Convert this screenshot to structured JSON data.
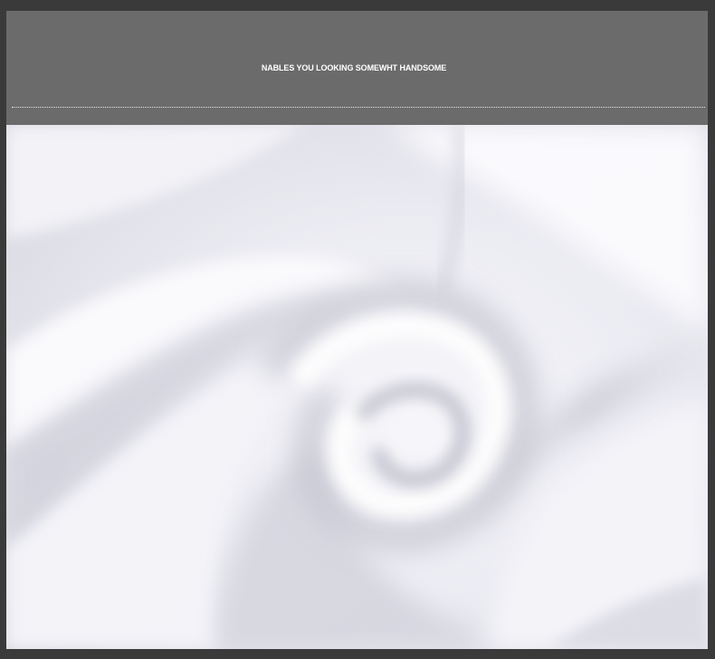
{
  "banner": {
    "text": "NABLES YOU LOOKING SOMEWHT HANDSOME"
  },
  "colors": {
    "page_background": "#3a3a3a",
    "banner_background": "#6b6b6b",
    "banner_text": "#ffffff",
    "fabric_base": "#e9e9ef"
  }
}
